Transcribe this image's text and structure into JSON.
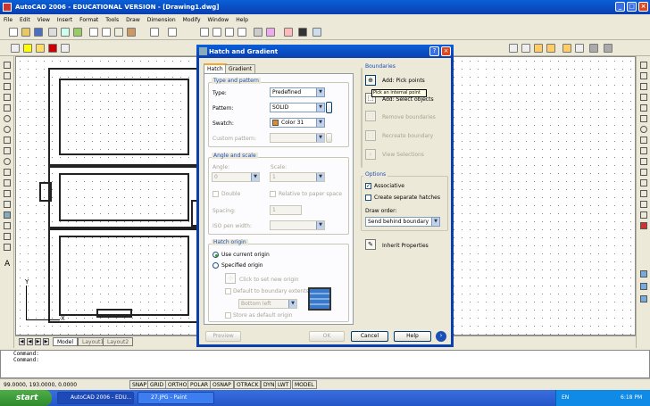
{
  "app": {
    "title": "AutoCAD 2006 - EDUCATIONAL VERSION - [Drawing1.dwg]",
    "menu": [
      "File",
      "Edit",
      "View",
      "Insert",
      "Format",
      "Tools",
      "Draw",
      "Dimension",
      "Modify",
      "Window",
      "Help"
    ]
  },
  "layout_tabs": {
    "model": "Model",
    "layout1": "Layout1",
    "layout2": "Layout2"
  },
  "command": {
    "line1": "Command:",
    "line2": "Command:"
  },
  "status": {
    "coords": "99.0000, 193.0000, 0.0000",
    "buttons": [
      "SNAP",
      "GRID",
      "ORTHO",
      "POLAR",
      "OSNAP",
      "OTRACK",
      "DYN",
      "LWT",
      "MODEL"
    ]
  },
  "taskbar": {
    "start": "start",
    "tasks": [
      "AutoCAD 2006 - EDU...",
      "27.JPG - Paint"
    ],
    "lang": "EN",
    "time": "6:18 PM"
  },
  "dialog": {
    "title": "Hatch and Gradient",
    "tabs": {
      "hatch": "Hatch",
      "gradient": "Gradient"
    },
    "type_pattern": {
      "title": "Type and pattern",
      "type_label": "Type:",
      "type_value": "Predefined",
      "pattern_label": "Pattern:",
      "pattern_value": "SOLID",
      "swatch_label": "Swatch:",
      "swatch_value": "Color 31",
      "custom_label": "Custom pattern:"
    },
    "angle_scale": {
      "title": "Angle and scale",
      "angle_label": "Angle:",
      "angle_value": "0",
      "scale_label": "Scale:",
      "scale_value": "1",
      "double": "Double",
      "relative": "Relative to paper space",
      "spacing_label": "Spacing:",
      "spacing_value": "1",
      "iso_label": "ISO pen width:"
    },
    "origin": {
      "title": "Hatch origin",
      "use_current": "Use current origin",
      "specified": "Specified origin",
      "click_set": "Click to set new origin",
      "default_ext": "Default to boundary extents",
      "pos_value": "Bottom left",
      "store": "Store as default origin"
    },
    "boundaries": {
      "title": "Boundaries",
      "add_pick": "Add: Pick points",
      "add_select": "Add: Select objects",
      "remove": "Remove boundaries",
      "recreate": "Recreate boundary",
      "view": "View Selections",
      "tooltip": "Pick an internal point"
    },
    "options": {
      "title": "Options",
      "associative": "Associative",
      "separate": "Create separate hatches",
      "draw_order_label": "Draw order:",
      "draw_order_value": "Send behind boundary"
    },
    "inherit": "Inherit Properties",
    "buttons": {
      "preview": "Preview",
      "ok": "OK",
      "cancel": "Cancel",
      "help": "Help"
    },
    "swatch_color": "#d98f2b"
  }
}
